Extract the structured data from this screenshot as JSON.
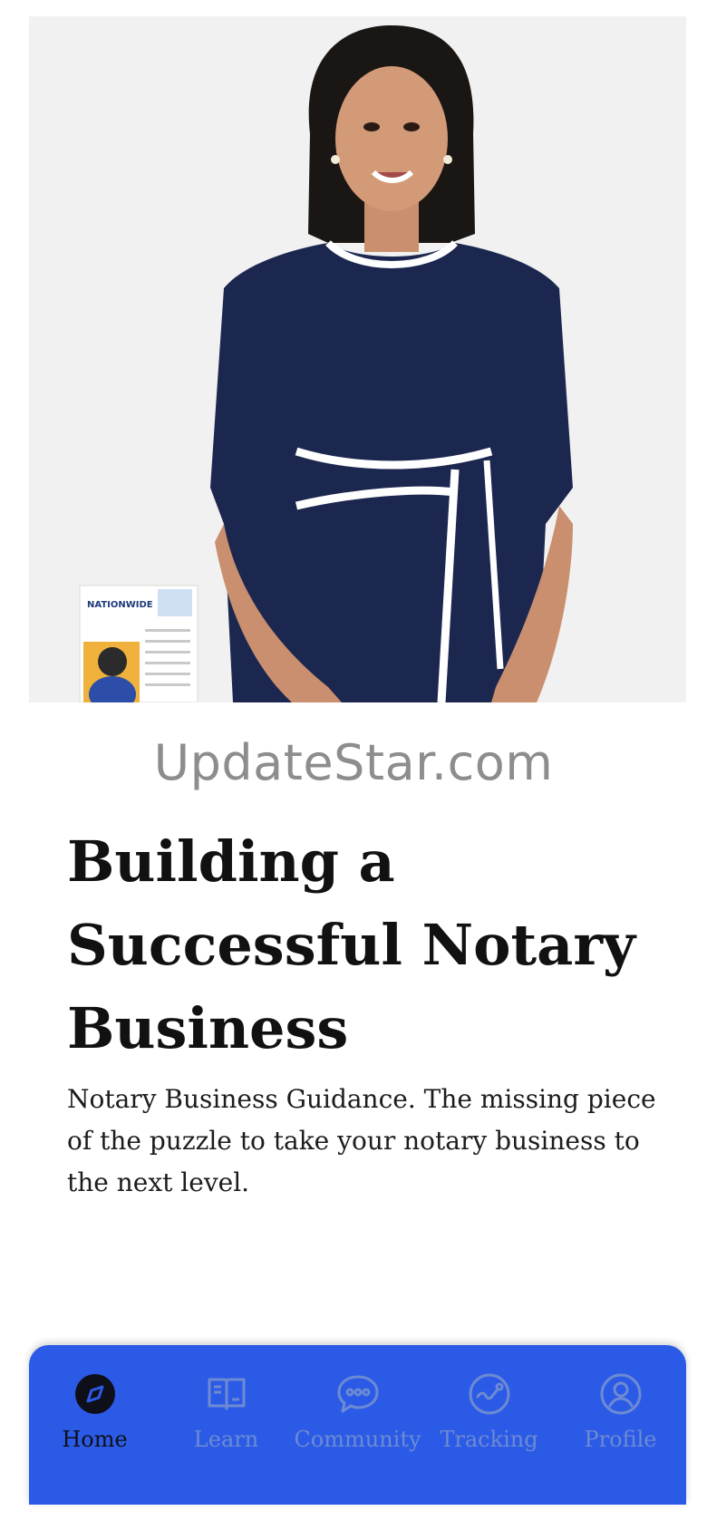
{
  "hero": {
    "alt": "Woman in navy dress standing beside a flyer",
    "flyer_text": "NATIONWIDE"
  },
  "watermark": "UpdateStar.com",
  "title_lines": [
    "Building a",
    "Successful Notary",
    "Business"
  ],
  "description_lines": [
    "Notary Business Guidance. The missing piece",
    "of the puzzle to take your notary business to",
    "the next level."
  ],
  "nav": {
    "active_color": "#0f0f1a",
    "inactive_color": "#6d8ad3",
    "background": "#2b5be6",
    "items": [
      {
        "label": "Home",
        "icon": "compass-icon",
        "active": true
      },
      {
        "label": "Learn",
        "icon": "book-icon",
        "active": false
      },
      {
        "label": "Community",
        "icon": "chat-bubble-icon",
        "active": false
      },
      {
        "label": "Tracking",
        "icon": "tracking-icon",
        "active": false
      },
      {
        "label": "Profile",
        "icon": "user-circle-icon",
        "active": false
      }
    ]
  }
}
